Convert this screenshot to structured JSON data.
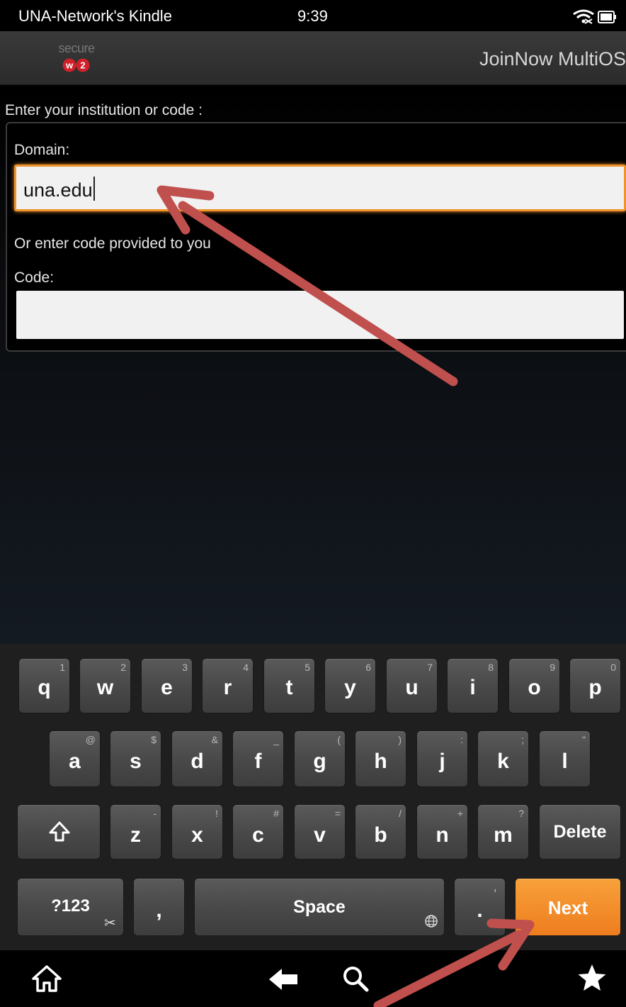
{
  "status_bar": {
    "device_name": "UNA-Network's Kindle",
    "time": "9:39"
  },
  "header": {
    "logo_text": "secure",
    "logo_badge": "W2",
    "title": "JoinNow MultiOS"
  },
  "form": {
    "prompt": "Enter your institution or code :",
    "domain_label": "Domain:",
    "domain_value": "una.edu",
    "alt_prompt": "Or enter code provided to you",
    "code_label": "Code:",
    "code_value": ""
  },
  "keyboard": {
    "row1": [
      {
        "label": "q",
        "sub": "1"
      },
      {
        "label": "w",
        "sub": "2"
      },
      {
        "label": "e",
        "sub": "3"
      },
      {
        "label": "r",
        "sub": "4"
      },
      {
        "label": "t",
        "sub": "5"
      },
      {
        "label": "y",
        "sub": "6"
      },
      {
        "label": "u",
        "sub": "7"
      },
      {
        "label": "i",
        "sub": "8"
      },
      {
        "label": "o",
        "sub": "9"
      },
      {
        "label": "p",
        "sub": "0"
      }
    ],
    "row2": [
      {
        "label": "a",
        "sub": "@"
      },
      {
        "label": "s",
        "sub": "$"
      },
      {
        "label": "d",
        "sub": "&"
      },
      {
        "label": "f",
        "sub": "_"
      },
      {
        "label": "g",
        "sub": "("
      },
      {
        "label": "h",
        "sub": ")"
      },
      {
        "label": "j",
        "sub": ":"
      },
      {
        "label": "k",
        "sub": ";"
      },
      {
        "label": "l",
        "sub": "\""
      }
    ],
    "row3": [
      {
        "label": "z",
        "sub": "-"
      },
      {
        "label": "x",
        "sub": "!"
      },
      {
        "label": "c",
        "sub": "#"
      },
      {
        "label": "v",
        "sub": "="
      },
      {
        "label": "b",
        "sub": "/"
      },
      {
        "label": "n",
        "sub": "+"
      },
      {
        "label": "m",
        "sub": "?"
      }
    ],
    "shift_icon": "shift-arrow-icon",
    "delete_label": "Delete",
    "symbols_label": "?123",
    "comma_label": ",",
    "space_label": "Space",
    "period_label": ".",
    "period_sub": "'",
    "next_label": "Next",
    "accent_color": "#F08A24"
  },
  "nav_bar": {
    "icons": [
      "home-icon",
      "back-icon",
      "search-icon",
      "favorites-icon"
    ]
  },
  "annotation_color": "#C0504D"
}
